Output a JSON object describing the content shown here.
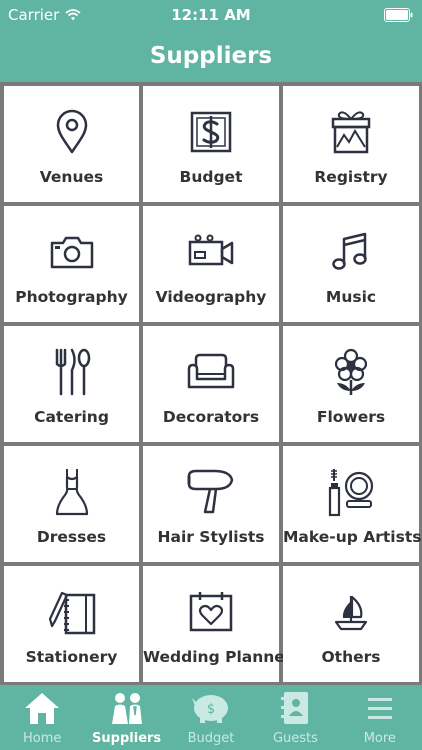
{
  "status": {
    "carrier": "Carrier",
    "time": "12:11 AM"
  },
  "nav": {
    "title": "Suppliers"
  },
  "categories": [
    {
      "label": "Venues",
      "icon": "location-pin-icon"
    },
    {
      "label": "Budget",
      "icon": "dollar-icon"
    },
    {
      "label": "Registry",
      "icon": "gift-icon"
    },
    {
      "label": "Photography",
      "icon": "camera-icon"
    },
    {
      "label": "Videography",
      "icon": "video-camera-icon"
    },
    {
      "label": "Music",
      "icon": "music-note-icon"
    },
    {
      "label": "Catering",
      "icon": "cutlery-icon"
    },
    {
      "label": "Decorators",
      "icon": "armchair-icon"
    },
    {
      "label": "Flowers",
      "icon": "flower-icon"
    },
    {
      "label": "Dresses",
      "icon": "dress-icon"
    },
    {
      "label": "Hair Stylists",
      "icon": "hair-dryer-icon"
    },
    {
      "label": "Make-up Artists",
      "icon": "makeup-icon"
    },
    {
      "label": "Stationery",
      "icon": "notebook-icon"
    },
    {
      "label": "Wedding Planners",
      "icon": "calendar-heart-icon"
    },
    {
      "label": "Others",
      "icon": "sailboat-icon"
    }
  ],
  "tabs": [
    {
      "label": "Home",
      "icon": "house-icon",
      "active": false
    },
    {
      "label": "Suppliers",
      "icon": "couple-icon",
      "active": true
    },
    {
      "label": "Budget",
      "icon": "piggy-bank-icon",
      "active": false
    },
    {
      "label": "Guests",
      "icon": "address-book-icon",
      "active": false
    },
    {
      "label": "More",
      "icon": "menu-icon",
      "active": false
    }
  ],
  "colors": {
    "accent": "#5fb4a2",
    "grid_line": "#7a7a7a",
    "icon": "#2e3140",
    "label": "#333333"
  }
}
